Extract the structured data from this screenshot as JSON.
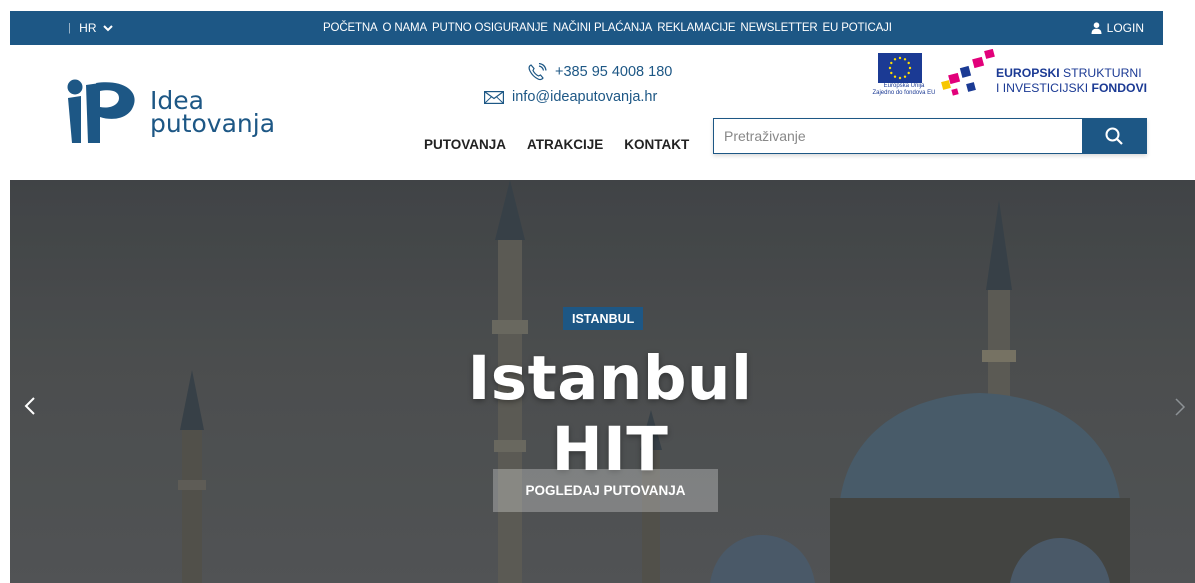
{
  "topbar": {
    "language": "HR",
    "nav": [
      "POČETNA",
      "O NAMA",
      "PUTNO OSIGURANJE",
      "NAČINI PLAĆANJA",
      "REKLAMACIJE",
      "NEWSLETTER",
      "EU POTICAJI"
    ],
    "login": "LOGIN"
  },
  "header": {
    "logo_line1": "Idea",
    "logo_line2": "putovanja",
    "phone": "+385 95 4008 180",
    "email": "info@ideaputovanja.hr",
    "main_nav": [
      "PUTOVANJA",
      "ATRAKCIJE",
      "KONTAKT"
    ],
    "search_placeholder": "Pretraživanje",
    "eu_caption_line1": "Europska Unija",
    "eu_caption_line2": "Zajedno do fondova EU",
    "esf_line1_bold": "EUROPSKI",
    "esf_line1_rest": " STRUKTURNI",
    "esf_line2_rest": "I INVESTICIJSKI ",
    "esf_line2_bold": "FONDOVI"
  },
  "hero": {
    "tag": "ISTANBUL",
    "title": "Istanbul HIT",
    "button": "POGLEDAJ PUTOVANJA"
  },
  "colors": {
    "brand_blue": "#1d5785",
    "eu_blue": "#1b3a94",
    "accent_pink": "#e2007a"
  }
}
